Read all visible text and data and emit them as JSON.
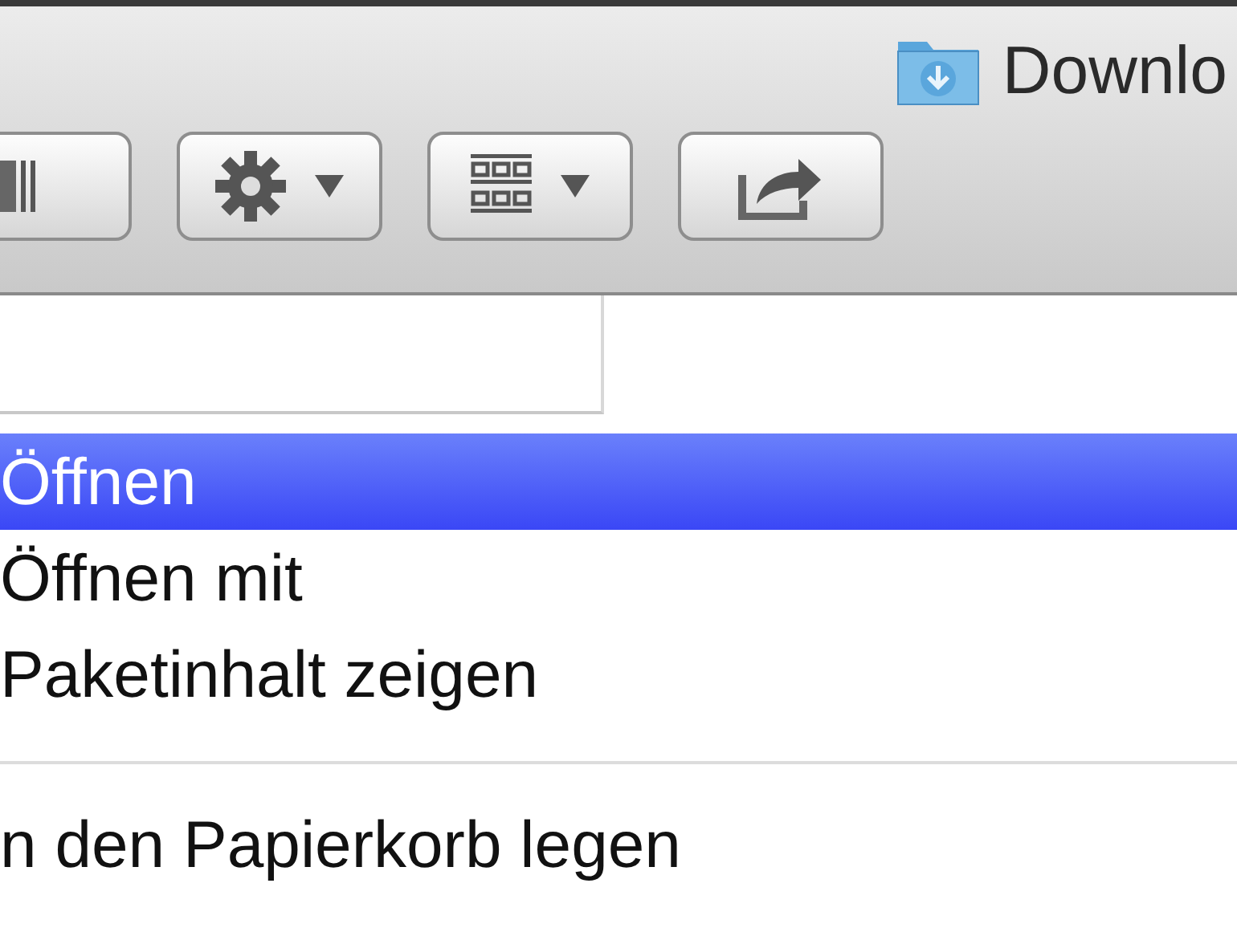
{
  "window": {
    "title": "Downlo"
  },
  "toolbar": {
    "buttons": [
      {
        "kind": "coverflow",
        "menu": false
      },
      {
        "kind": "action",
        "menu": true
      },
      {
        "kind": "arrange",
        "menu": true
      },
      {
        "kind": "share",
        "menu": false
      }
    ]
  },
  "context_menu": {
    "items": [
      {
        "kind": "item",
        "label": "Öffnen",
        "selected": true
      },
      {
        "kind": "item",
        "label": "Öffnen mit",
        "selected": false
      },
      {
        "kind": "item",
        "label": "Paketinhalt zeigen",
        "selected": false
      },
      {
        "kind": "separator"
      },
      {
        "kind": "item",
        "label": "n den Papierkorb legen",
        "selected": false
      }
    ]
  }
}
